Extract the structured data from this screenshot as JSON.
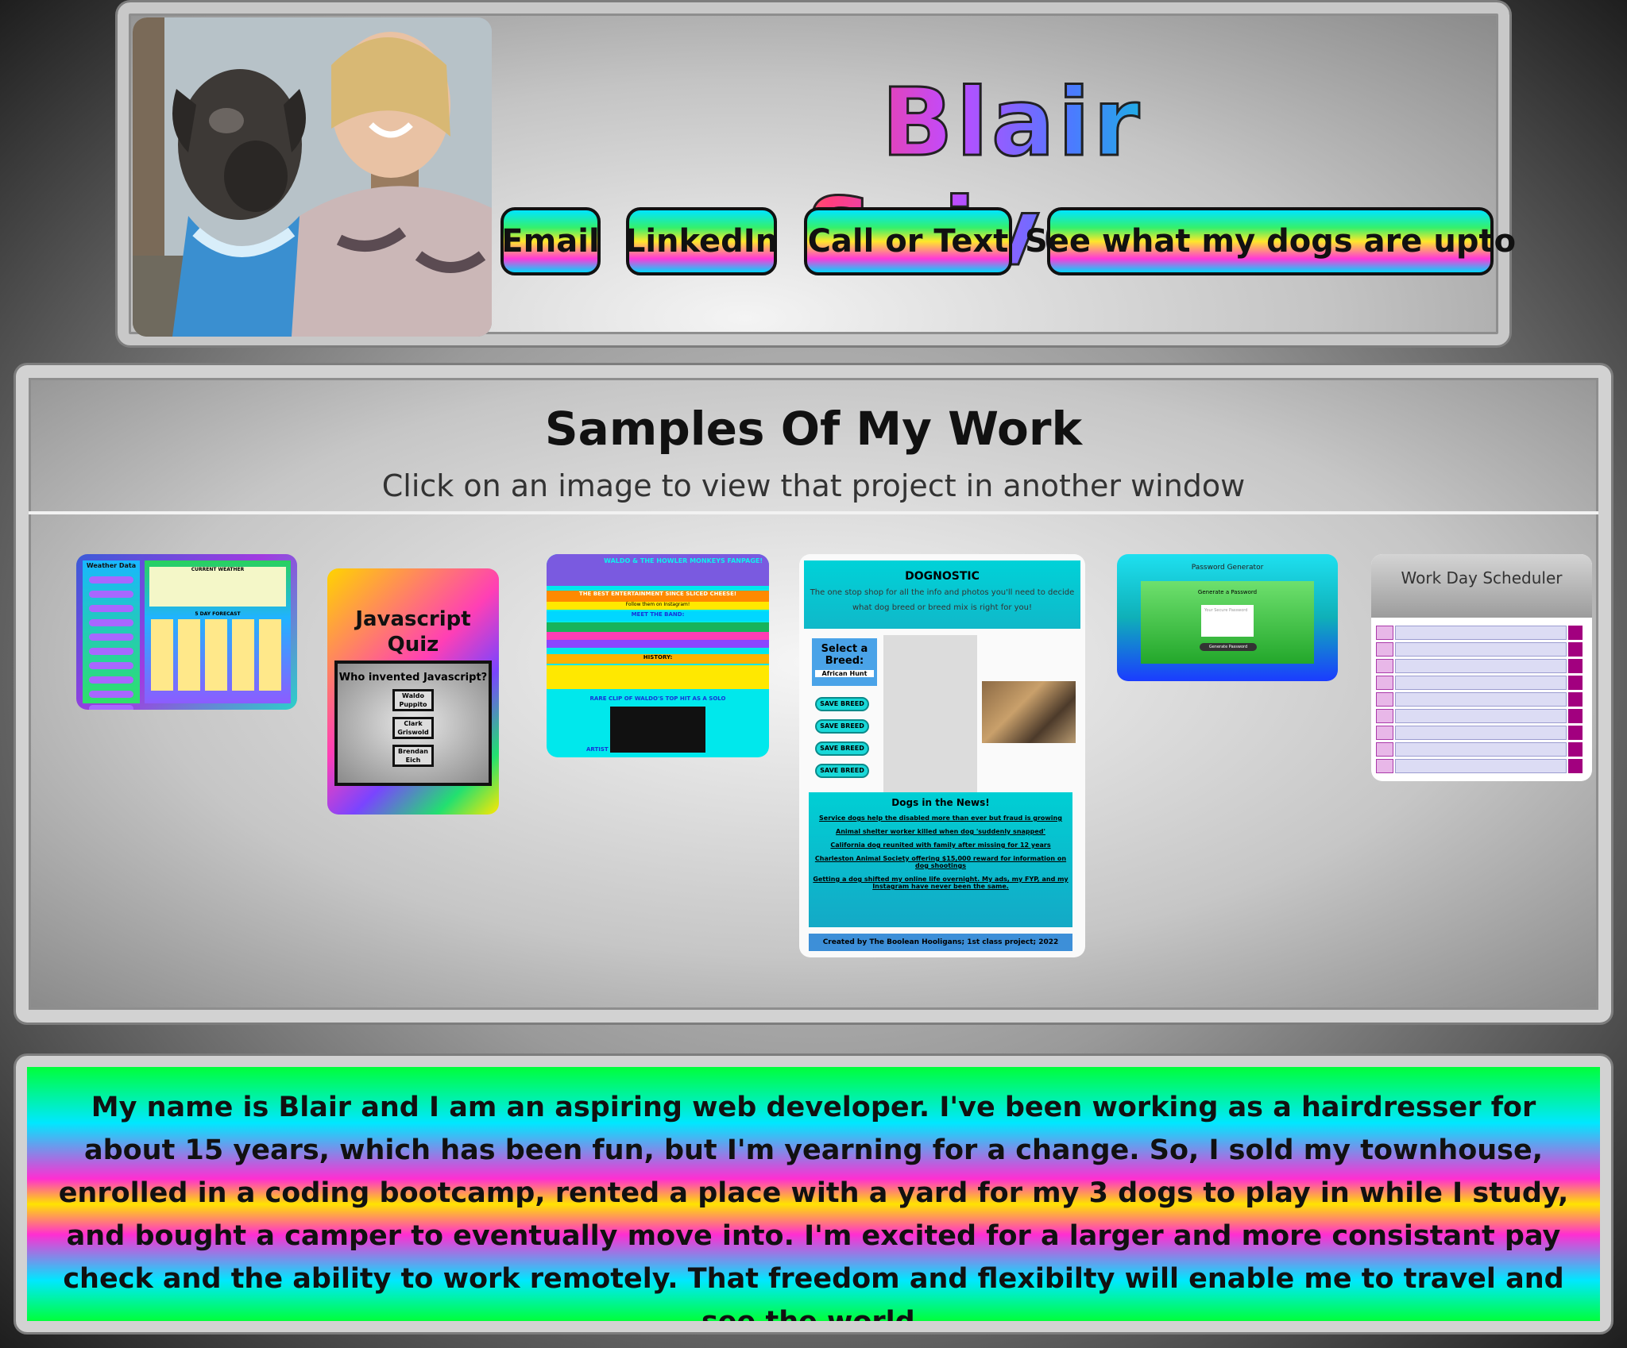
{
  "header": {
    "name": "Blair Seivers",
    "buttons": {
      "email": "Email",
      "linkedin": "LinkedIn",
      "call": "Call or Text",
      "dogs": "See what my dogs are upto"
    }
  },
  "work": {
    "title": "Samples Of My Work",
    "subtitle": "Click on an image to view that project in another window",
    "projects": {
      "weather": {
        "label": "Weather Data",
        "current": "CURRENT WEATHER",
        "forecast": "5 DAY FORECAST"
      },
      "quiz": {
        "title_line1": "Javascript",
        "title_line2": "Quiz",
        "question": "Who invented Javascript?",
        "answers": [
          "Waldo Puppito",
          "Clark Griswold",
          "Brendan Eich"
        ]
      },
      "fanpage": {
        "title": "WALDO & THE HOWLER MONKEYS FANPAGE!",
        "tagline": "THE BEST ENTERTAINMENT SINCE SLICED CHEESE!",
        "follow": "Follow them on Instagram!",
        "meet": "MEET THE BAND:",
        "history": "HISTORY:",
        "clip": "RARE CLIP OF WALDO'S TOP HIT AS A SOLO",
        "artist": "ARTIST"
      },
      "dognostic": {
        "title": "DOGNOSTIC",
        "desc": "The one stop shop for all the info and photos you'll need to decide what dog breed or breed mix is right for you!",
        "select": "Select a Breed:",
        "breed_value": "African Hunt",
        "save": "SAVE BREED",
        "news_title": "Dogs in the News!",
        "news": [
          "Service dogs help the disabled more than ever but fraud is growing",
          "Animal shelter worker killed when dog 'suddenly snapped'",
          "California dog reunited with family after missing for 12 years",
          "Charleston Animal Society offering $15,000 reward for information on dog shootings",
          "Getting a dog shifted my online life overnight. My ads, my FYP, and my Instagram have never been the same."
        ],
        "footer": "Created by The Boolean Hooligans; 1st class project; 2022"
      },
      "password": {
        "title": "Password Generator",
        "card": "Generate a Password",
        "placeholder": "Your Secure Password",
        "button": "Generate Password"
      },
      "scheduler": {
        "title": "Work Day Scheduler"
      }
    }
  },
  "bio": {
    "text": "My name is Blair and I am an aspiring web developer. I've been working as a hairdresser for about 15 years, which has been fun, but I'm yearning for a change. So, I sold my townhouse, enrolled in a coding bootcamp, rented a place with a yard for my 3 dogs to play in while I study, and bought a camper to eventually move into. I'm excited for a larger and more consistant pay check and the ability to work remotely. That freedom and flexibilty will enable me to travel and see the world."
  }
}
